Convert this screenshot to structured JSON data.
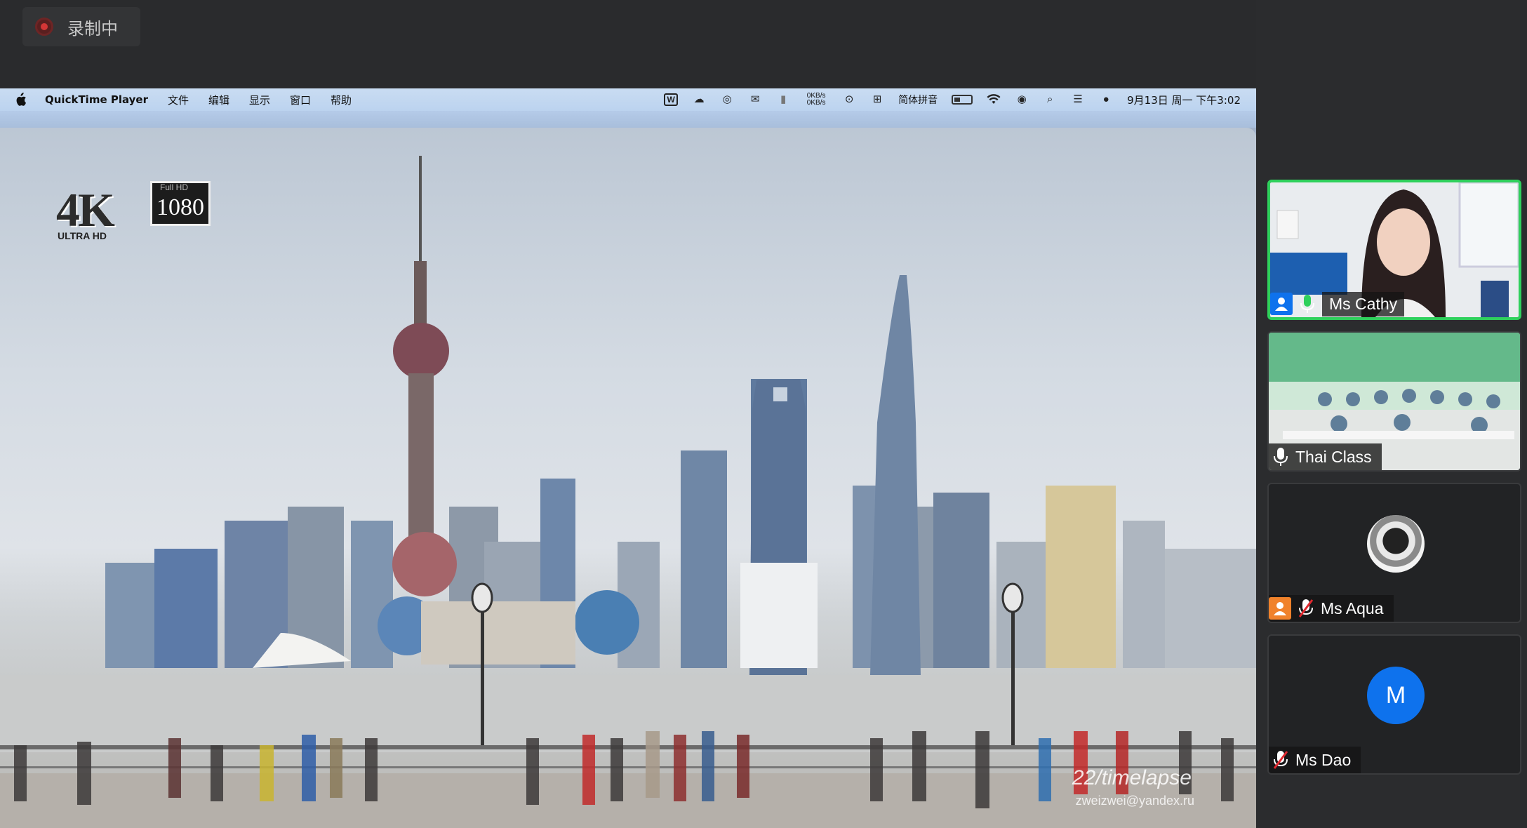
{
  "recording": {
    "label": "录制中"
  },
  "menubar": {
    "app_name": "QuickTime Player",
    "items": [
      "文件",
      "编辑",
      "显示",
      "窗口",
      "帮助"
    ],
    "net_speed_up": "0KB/s",
    "net_speed_down": "0KB/s",
    "input_method": "简体拼音",
    "clock": "9月13日 周一 下午3:02"
  },
  "video": {
    "badge_4k": "4K",
    "badge_uhd": "ULTRA HD",
    "badge_fullhd": "Full HD",
    "badge_1080": "1080",
    "watermark": "22/timelapse",
    "watermark_email": "zweizwei@yandex.ru"
  },
  "participants": [
    {
      "name": "Ms Cathy",
      "active": true,
      "host": true,
      "muted": false
    },
    {
      "name": "Thai Class",
      "active": false,
      "host": false,
      "muted": false
    },
    {
      "name": "Ms Aqua",
      "active": false,
      "host": true,
      "muted": true
    },
    {
      "name": "Ms Dao",
      "active": false,
      "host": false,
      "muted": true,
      "avatar_letter": "M"
    }
  ],
  "colors": {
    "active_speaker": "#2fd05c",
    "host_badge": "#0e72ed",
    "cohost_badge": "#f0822b",
    "recording": "#d33636"
  }
}
